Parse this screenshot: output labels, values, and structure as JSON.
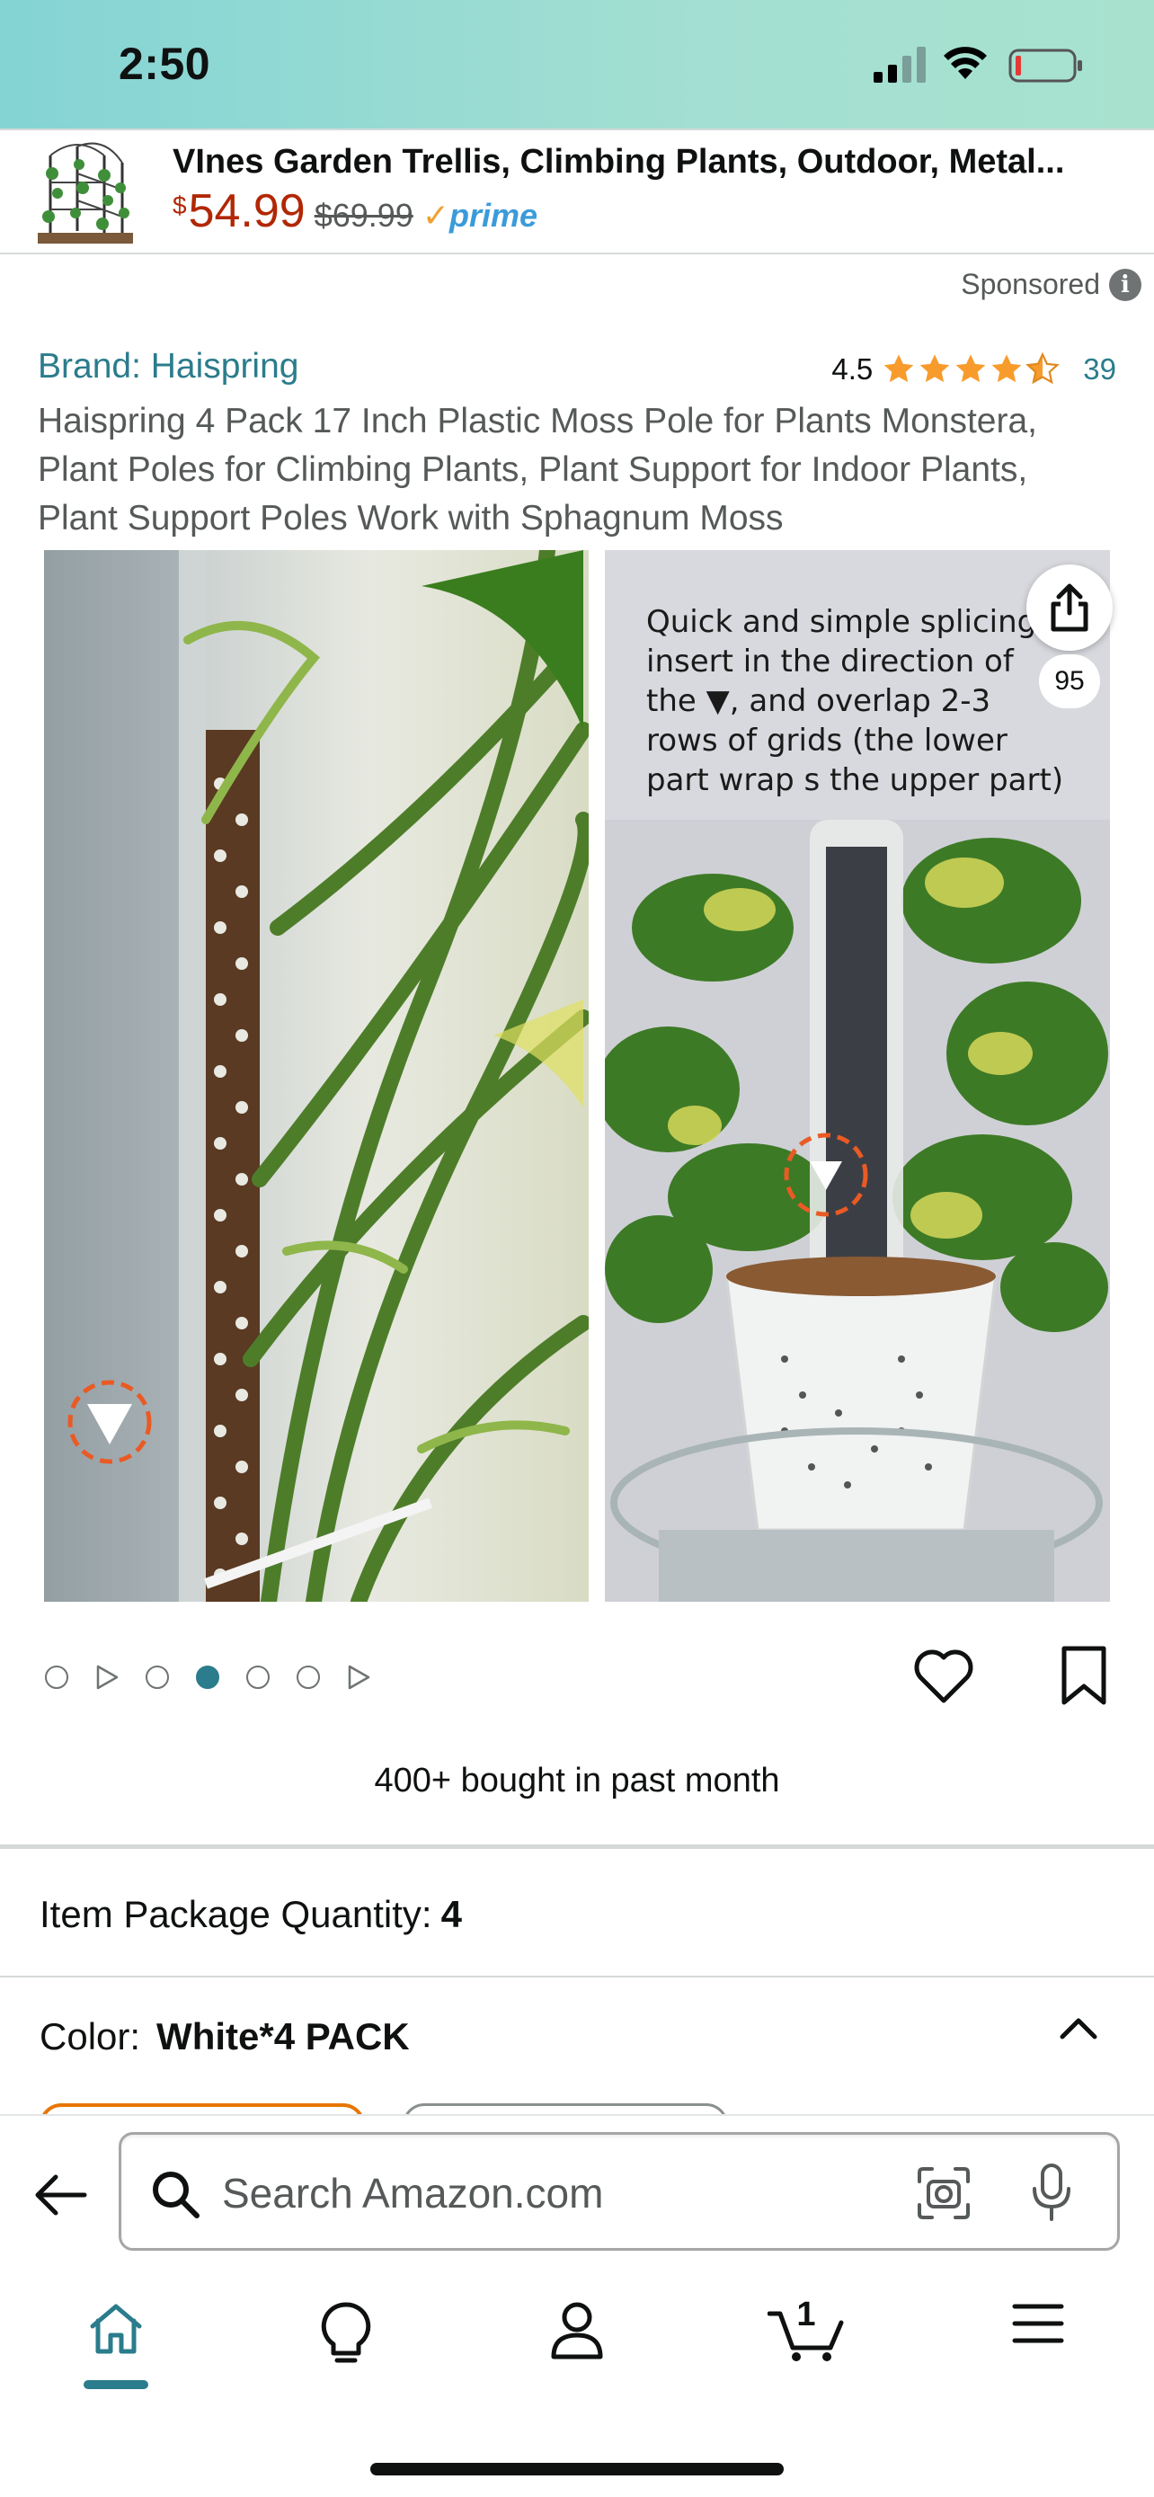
{
  "status_bar": {
    "time": "2:50"
  },
  "banner": {
    "title": "VInes Garden Trellis, Climbing Plants, Outdoor, Metal...",
    "price_symbol": "$",
    "price": "54.99",
    "list_price": "$69.99",
    "prime_check": "✓",
    "prime_label": "prime",
    "sponsored_label": "Sponsored"
  },
  "product": {
    "brand": "Brand: Haispring",
    "rating": "4.5",
    "stars": 4.5,
    "rating_count": "39",
    "title": "Haispring 4 Pack 17 Inch Plastic Moss Pole for Plants Monstera, Plant Poles for Climbing Plants, Plant Support for Indoor Plants, Plant Support Poles Work with Sphagnum Moss",
    "image_caption": "Quick and simple splicing, insert in the direction of the ▼, and overlap 2-3 rows of grids (the lower part wrap s the upper part)",
    "image_count": "95",
    "bought": "400+ bought in past month",
    "quantity_label": "Item Package Quantity:",
    "quantity_value": "4",
    "color_label": "Color:",
    "color_value": "White*4 PACK"
  },
  "carousel": {
    "items": [
      "dot",
      "play",
      "dot",
      "dot-active",
      "dot",
      "dot",
      "play"
    ]
  },
  "search": {
    "placeholder": "Search Amazon.com"
  },
  "nav": {
    "cart_count": "1",
    "items": [
      "home-icon",
      "inspire-icon",
      "account-icon",
      "cart-icon",
      "menu-icon"
    ]
  },
  "colors": {
    "teal_accent": "#2b7c8c",
    "price_red": "#b12704",
    "star_orange": "#f79c2c",
    "status_bar": "#a3dfd2"
  }
}
